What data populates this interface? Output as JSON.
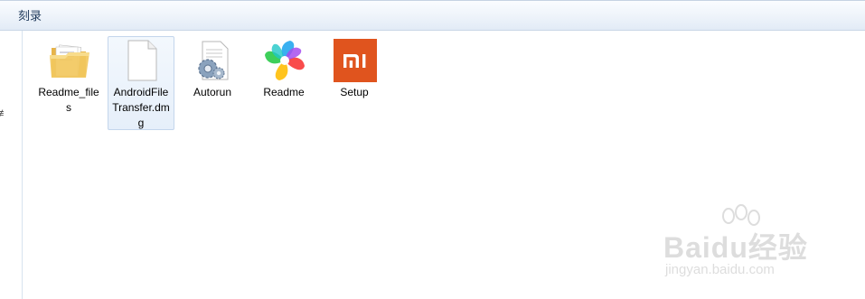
{
  "toolbar": {
    "burn_label": "刻录"
  },
  "files": [
    {
      "name": "Readme_files",
      "icon": "folder-icon"
    },
    {
      "name": "AndroidFileTransfer.dmg",
      "icon": "blank-file-icon",
      "selected": true
    },
    {
      "name": "Autorun",
      "icon": "settings-file-icon"
    },
    {
      "name": "Readme",
      "icon": "browser-pinwheel-icon"
    },
    {
      "name": "Setup",
      "icon": "mi-logo-icon"
    }
  ],
  "nav": {
    "glyph": "≢"
  },
  "watermark": {
    "main": "Baidu经验",
    "sub": "jingyan.baidu.com"
  },
  "colors": {
    "mi_orange": "#e0541e",
    "folder_yellow": "#f2c85e",
    "selection": "#e6effa"
  }
}
